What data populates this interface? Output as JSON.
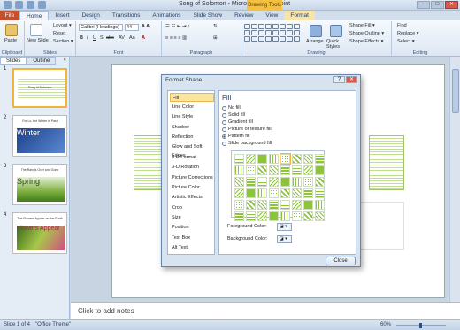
{
  "window": {
    "title": "Song of Solomon - Microsoft PowerPoint",
    "context_tab_group": "Drawing Tools",
    "controls": [
      "–",
      "□",
      "✕"
    ]
  },
  "ribbon_tabs": [
    "File",
    "Home",
    "Insert",
    "Design",
    "Transitions",
    "Animations",
    "Slide Show",
    "Review",
    "View",
    "Format"
  ],
  "ribbon": {
    "clipboard": {
      "paste": "Paste",
      "label": "Clipboard"
    },
    "slides": {
      "new_slide": "New Slide",
      "layout": "Layout ▾",
      "reset": "Reset",
      "section": "Section ▾",
      "label": "Slides"
    },
    "font": {
      "name": "Calibri (Headings)",
      "size": "44",
      "label": "Font"
    },
    "paragraph": {
      "label": "Paragraph"
    },
    "drawing": {
      "arrange": "Arrange",
      "quick_styles": "Quick Styles",
      "shape_fill": "Shape Fill ▾",
      "shape_outline": "Shape Outline ▾",
      "shape_effects": "Shape Effects ▾",
      "label": "Drawing"
    },
    "editing": {
      "find": "Find",
      "replace": "Replace ▾",
      "select": "Select ▾",
      "label": "Editing"
    }
  },
  "panel_tabs": [
    "Slides",
    "Outline",
    "×"
  ],
  "slides": [
    {
      "num": "1",
      "title": "Song of Solomon",
      "word": ""
    },
    {
      "num": "2",
      "title": "For Lo, the Winter is Past",
      "word": "Winter"
    },
    {
      "num": "3",
      "title": "The Rain is Over and Gone",
      "word": "Spring"
    },
    {
      "num": "4",
      "title": "The Flowers Appear on the Earth",
      "word": "Flowers Appear"
    }
  ],
  "notes_placeholder": "Click to add notes",
  "status": {
    "slide": "Slide 1 of 4",
    "theme": "\"Office Theme\"",
    "zoom": "60%"
  },
  "dialog": {
    "title": "Format Shape",
    "categories": [
      "Fill",
      "Line Color",
      "Line Style",
      "Shadow",
      "Reflection",
      "Glow and Soft Edges",
      "3-D Format",
      "3-D Rotation",
      "Picture Corrections",
      "Picture Color",
      "Artistic Effects",
      "Crop",
      "Size",
      "Position",
      "Text Box",
      "Alt Text"
    ],
    "selected_category": "Fill",
    "heading": "Fill",
    "options": [
      "No fill",
      "Solid fill",
      "Gradient fill",
      "Picture or texture fill",
      "Pattern fill",
      "Slide background fill"
    ],
    "selected_option": "Pattern fill",
    "foreground_label": "Foreground Color:",
    "background_label": "Background Color:",
    "close": "Close",
    "colors": {
      "pattern_green": "#8cc43c",
      "selection": "#f0b43a"
    }
  }
}
